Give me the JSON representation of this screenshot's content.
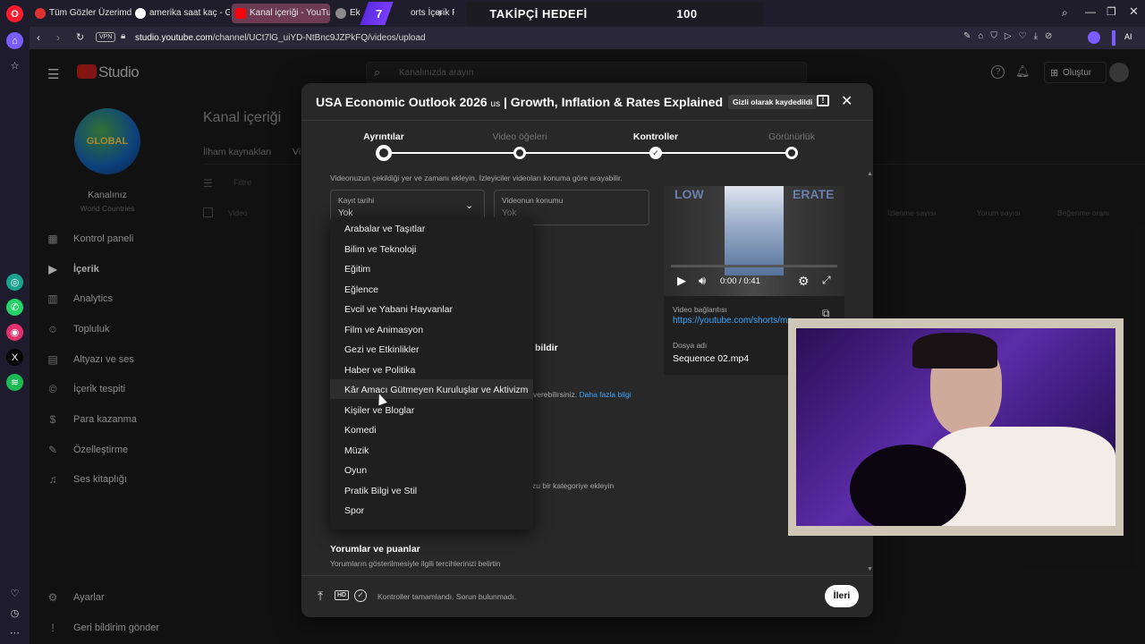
{
  "browser": {
    "tabs": [
      {
        "label": "Tüm Gözler Üzerimde",
        "fav_color": "#e03131"
      },
      {
        "label": "amerika saat kaç - Google",
        "fav_color": "#ffffff"
      },
      {
        "label": "Kanal içeriği - YouTube St",
        "fav_color": "#ff0000"
      },
      {
        "label": "Ek",
        "fav_color": "#8a8a8a"
      },
      {
        "label": "orts İçerik Fik",
        "fav_color": "#8a8a8a"
      }
    ],
    "new_tab": "+",
    "overlay_number": "7",
    "overlay_title": "TAKİPÇİ HEDEFİ",
    "overlay_count": "100",
    "vpn_label": "VPN",
    "url_host": "studio.youtube.com",
    "url_path": "/channel/UCt7lG_uiYD-NtBnc9JZPkFQ/videos/upload",
    "ai_label": "AI"
  },
  "studio": {
    "logo": "Studio",
    "search_placeholder": "Kanalınızda arayın",
    "create_label": "Oluştur",
    "channel_name": "Kanalınız",
    "channel_sub": "World Countries",
    "avatar_text": "GLOBAL",
    "page_title": "Kanal içeriği",
    "tab_inspiration": "İlham kaynakları",
    "tab_video": "Vi",
    "filter": "Filtre",
    "col_video": "Video",
    "col_views": "İzlenme sayısı",
    "col_comments": "Yorum sayısı",
    "col_likes": "Beğenme oranı",
    "nav": [
      {
        "label": "Kontrol paneli",
        "icon": "dashboard-icon"
      },
      {
        "label": "İçerik",
        "icon": "content-icon"
      },
      {
        "label": "Analytics",
        "icon": "analytics-icon"
      },
      {
        "label": "Topluluk",
        "icon": "community-icon"
      },
      {
        "label": "Altyazı ve ses",
        "icon": "subtitles-icon"
      },
      {
        "label": "İçerik tespiti",
        "icon": "copyright-icon"
      },
      {
        "label": "Para kazanma",
        "icon": "monetization-icon"
      },
      {
        "label": "Özelleştirme",
        "icon": "customization-icon"
      },
      {
        "label": "Ses kitaplığı",
        "icon": "audio-library-icon"
      }
    ],
    "settings": "Ayarlar",
    "feedback": "Geri bildirim gönder"
  },
  "modal": {
    "title": "USA Economic Outlook 2026 ",
    "title_flag": "us",
    "title_rest": " | Growth, Inflation & Rates Explained",
    "saved_badge": "Gizli olarak kaydedildi",
    "steps": [
      "Ayrıntılar",
      "Video öğeleri",
      "Kontroller",
      "Görünürlük"
    ],
    "location_hint": "Videonuzun çekildiği yer ve zamanı ekleyin. İzleyiciler videoları konuma göre arayabilir.",
    "date_label": "Kayıt tarihi",
    "date_value": "Yok",
    "location_label": "Videonun konumu",
    "location_value": "Yok",
    "video_time": "0:00 / 0:41",
    "video_link_label": "Video bağlantısı",
    "video_link": "https://youtube.com/shorts/mz",
    "file_label": "Dosya adı",
    "file_name": "Sequence 02.mp4",
    "thumb_text": "LOW",
    "thumb_text2": "ERATE",
    "partial_bildir": "bildir",
    "partial_learn": "verebilirsiniz.",
    "learn_more": "Daha fazla bilgi",
    "partial_category": "zu bir kategoriye ekleyin",
    "comments_title": "Yorumlar ve puanlar",
    "comments_sub": "Yorumların gösterilmesiyle ilgili tercihlerinizi belirtin",
    "footer_status": "Kontroller tamamlandı. Sorun bulunmadı.",
    "next_button": "İleri",
    "hd_badge": "HD"
  },
  "dropdown": {
    "items": [
      "Arabalar ve Taşıtlar",
      "Bilim ve Teknoloji",
      "Eğitim",
      "Eğlence",
      "Evcil ve Yabani Hayvanlar",
      "Film ve Animasyon",
      "Gezi ve Etkinlikler",
      "Haber ve Politika",
      "Kâr Amacı Gütmeyen Kuruluşlar ve Aktivizm",
      "Kişiler ve Bloglar",
      "Komedi",
      "Müzik",
      "Oyun",
      "Pratik Bilgi ve Stil",
      "Spor"
    ]
  }
}
